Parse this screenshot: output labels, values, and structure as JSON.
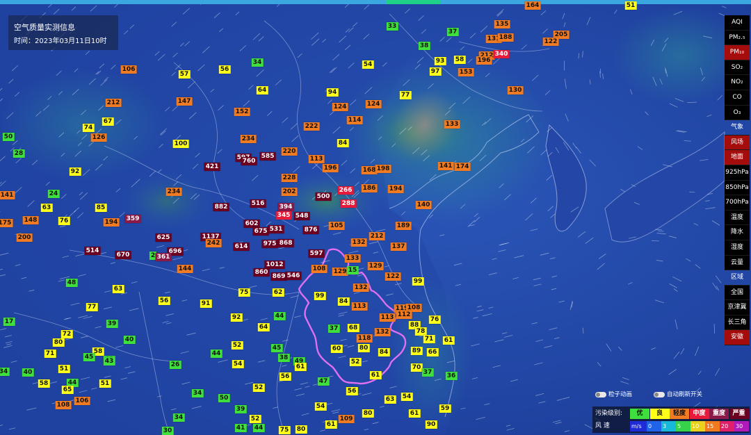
{
  "info": {
    "title": "空气质量实测信息",
    "time": "时间：2023年03月11日10时"
  },
  "colors": {
    "good": "#3fe03b",
    "moderate": "#ffff1a",
    "light": "#f07b22",
    "medium": "#e81a3a",
    "heavy": "#8b1a48",
    "severe": "#6b0020",
    "ocean": "#1f3f9e",
    "anhui_border": "#e070f0"
  },
  "layers": {
    "pollutants": [
      "AQI",
      "PM₂.₅",
      "PM₁₀",
      "SO₂",
      "NO₂",
      "CO",
      "O₃"
    ],
    "active_pollutant": "PM₁₀",
    "weather_header": "气象",
    "weather": [
      "风场",
      "地面",
      "925hPa",
      "850hPa",
      "700hPa",
      "温度",
      "降水",
      "湿度",
      "云量"
    ],
    "active_weather": [
      "风场",
      "地面"
    ],
    "region_header": "区域",
    "regions": [
      "全国",
      "京津冀",
      "长三角",
      "安徽"
    ],
    "active_region": "安徽"
  },
  "toggles": {
    "particle_animation": "粒子动画",
    "auto_refresh": "自动刷新开关"
  },
  "legend": {
    "pollution_title": "污染级别:",
    "levels": [
      {
        "label": "优",
        "color": "#3fe03b",
        "text": "#111"
      },
      {
        "label": "良",
        "color": "#ffff1a",
        "text": "#111"
      },
      {
        "label": "轻度",
        "color": "#f07b22",
        "text": "#111"
      },
      {
        "label": "中度",
        "color": "#e81a3a",
        "text": "#fff"
      },
      {
        "label": "重度",
        "color": "#8b1a48",
        "text": "#fff"
      },
      {
        "label": "严重",
        "color": "#6b0020",
        "text": "#fff"
      }
    ],
    "wind_title": "风   速",
    "wind_unit": "m/s",
    "wind_ticks": [
      "0",
      "3",
      "5",
      "10",
      "15",
      "20",
      "30"
    ]
  },
  "stations": [
    {
      "v": "33"
    },
    {
      "v": "37"
    },
    {
      "v": "164"
    },
    {
      "v": "51"
    },
    {
      "v": "135"
    },
    {
      "v": "131"
    },
    {
      "v": "188"
    },
    {
      "v": "205"
    },
    {
      "v": "122"
    },
    {
      "v": "38"
    },
    {
      "v": "212"
    },
    {
      "v": "340"
    },
    {
      "v": "93"
    },
    {
      "v": "58"
    },
    {
      "v": "196"
    },
    {
      "v": "34"
    },
    {
      "v": "54"
    },
    {
      "v": "97"
    },
    {
      "v": "153"
    },
    {
      "v": "106"
    },
    {
      "v": "57"
    },
    {
      "v": "56"
    },
    {
      "v": "64"
    },
    {
      "v": "94"
    },
    {
      "v": "77"
    },
    {
      "v": "130"
    },
    {
      "v": "212"
    },
    {
      "v": "147"
    },
    {
      "v": "124"
    },
    {
      "v": "124"
    },
    {
      "v": "152"
    },
    {
      "v": "114"
    },
    {
      "v": "133"
    },
    {
      "v": "67"
    },
    {
      "v": "74"
    },
    {
      "v": "222"
    },
    {
      "v": "126"
    },
    {
      "v": "50"
    },
    {
      "v": "234"
    },
    {
      "v": "100"
    },
    {
      "v": "84"
    },
    {
      "v": "28"
    },
    {
      "v": "597"
    },
    {
      "v": "585"
    },
    {
      "v": "220"
    },
    {
      "v": "760"
    },
    {
      "v": "113"
    },
    {
      "v": "421"
    },
    {
      "v": "196"
    },
    {
      "v": "168"
    },
    {
      "v": "198"
    },
    {
      "v": "141"
    },
    {
      "v": "174"
    },
    {
      "v": "92"
    },
    {
      "v": "228"
    },
    {
      "v": "266"
    },
    {
      "v": "186"
    },
    {
      "v": "194"
    },
    {
      "v": "24"
    },
    {
      "v": "234"
    },
    {
      "v": "202"
    },
    {
      "v": "141"
    },
    {
      "v": "500"
    },
    {
      "v": "516"
    },
    {
      "v": "288"
    },
    {
      "v": "882"
    },
    {
      "v": "394"
    },
    {
      "v": "140"
    },
    {
      "v": "63"
    },
    {
      "v": "85"
    },
    {
      "v": "345"
    },
    {
      "v": "548"
    },
    {
      "v": "148"
    },
    {
      "v": "76"
    },
    {
      "v": "194"
    },
    {
      "v": "359"
    },
    {
      "v": "175"
    },
    {
      "v": "602"
    },
    {
      "v": "105"
    },
    {
      "v": "189"
    },
    {
      "v": "675"
    },
    {
      "v": "531"
    },
    {
      "v": "876"
    },
    {
      "v": "212"
    },
    {
      "v": "200"
    },
    {
      "v": "625"
    },
    {
      "v": "1137"
    },
    {
      "v": "132"
    },
    {
      "v": "242"
    },
    {
      "v": "975"
    },
    {
      "v": "868"
    },
    {
      "v": "137"
    },
    {
      "v": "614"
    },
    {
      "v": "514"
    },
    {
      "v": "696"
    },
    {
      "v": "670"
    },
    {
      "v": "2"
    },
    {
      "v": "361"
    },
    {
      "v": "597"
    },
    {
      "v": "133"
    },
    {
      "v": "1012"
    },
    {
      "v": "129"
    },
    {
      "v": "144"
    },
    {
      "v": "108"
    },
    {
      "v": "860"
    },
    {
      "v": "869"
    },
    {
      "v": "546"
    },
    {
      "v": "129"
    },
    {
      "v": "15"
    },
    {
      "v": "122"
    },
    {
      "v": "48"
    },
    {
      "v": "99"
    },
    {
      "v": "63"
    },
    {
      "v": "132"
    },
    {
      "v": "75"
    },
    {
      "v": "62"
    },
    {
      "v": "99"
    },
    {
      "v": "56"
    },
    {
      "v": "91"
    },
    {
      "v": "84"
    },
    {
      "v": "77"
    },
    {
      "v": "113"
    },
    {
      "v": "119"
    },
    {
      "v": "108"
    },
    {
      "v": "44"
    },
    {
      "v": "92"
    },
    {
      "v": "112"
    },
    {
      "v": "17"
    },
    {
      "v": "39"
    },
    {
      "v": "113"
    },
    {
      "v": "76"
    },
    {
      "v": "64"
    },
    {
      "v": "88"
    },
    {
      "v": "72"
    },
    {
      "v": "37"
    },
    {
      "v": "68"
    },
    {
      "v": "78"
    },
    {
      "v": "132"
    },
    {
      "v": "71"
    },
    {
      "v": "40"
    },
    {
      "v": "80"
    },
    {
      "v": "118"
    },
    {
      "v": "61"
    },
    {
      "v": "52"
    },
    {
      "v": "45"
    },
    {
      "v": "60"
    },
    {
      "v": "80"
    },
    {
      "v": "89"
    },
    {
      "v": "66"
    },
    {
      "v": "84"
    },
    {
      "v": "58"
    },
    {
      "v": "71"
    },
    {
      "v": "45"
    },
    {
      "v": "43"
    },
    {
      "v": "44"
    },
    {
      "v": "38"
    },
    {
      "v": "49"
    },
    {
      "v": "52"
    },
    {
      "v": "70"
    },
    {
      "v": "26"
    },
    {
      "v": "54"
    },
    {
      "v": "61"
    },
    {
      "v": "51"
    },
    {
      "v": "34"
    },
    {
      "v": "40"
    },
    {
      "v": "43"
    },
    {
      "v": "37"
    },
    {
      "v": "36"
    },
    {
      "v": "51"
    },
    {
      "v": "44"
    },
    {
      "v": "56"
    },
    {
      "v": "61"
    },
    {
      "v": "58"
    },
    {
      "v": "47"
    },
    {
      "v": "52"
    },
    {
      "v": "65"
    },
    {
      "v": "56"
    },
    {
      "v": "34"
    },
    {
      "v": "54"
    },
    {
      "v": "63"
    },
    {
      "v": "106"
    },
    {
      "v": "50"
    },
    {
      "v": "108"
    },
    {
      "v": "39"
    },
    {
      "v": "54"
    },
    {
      "v": "59"
    },
    {
      "v": "109"
    },
    {
      "v": "61"
    },
    {
      "v": "80"
    },
    {
      "v": "52"
    },
    {
      "v": "34"
    },
    {
      "v": "61"
    },
    {
      "v": "30"
    },
    {
      "v": "41"
    },
    {
      "v": "44"
    },
    {
      "v": "75"
    },
    {
      "v": "80"
    },
    {
      "v": "90"
    }
  ]
}
